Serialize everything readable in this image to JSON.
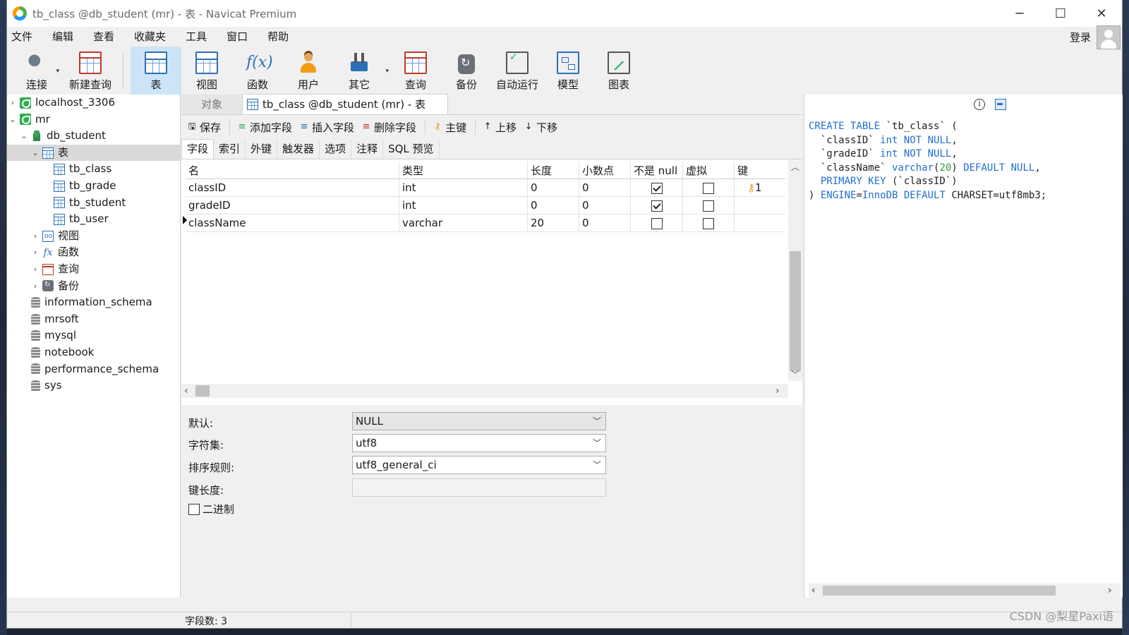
{
  "window": {
    "title": "tb_class @db_student (mr) - 表 - Navicat Premium",
    "controls": {
      "minimize": "─",
      "maximize": "☐",
      "close": "✕"
    }
  },
  "menubar": {
    "items": [
      "文件",
      "编辑",
      "查看",
      "收藏夹",
      "工具",
      "窗口",
      "帮助"
    ],
    "login": "登录"
  },
  "toolbar": {
    "items": [
      {
        "label": "连接",
        "icon": "connect-icon"
      },
      {
        "label": "新建查询",
        "icon": "new-query-icon"
      },
      {
        "label": "表",
        "icon": "table-icon",
        "active": true
      },
      {
        "label": "视图",
        "icon": "view-icon"
      },
      {
        "label": "函数",
        "icon": "function-icon"
      },
      {
        "label": "用户",
        "icon": "user-icon"
      },
      {
        "label": "其它",
        "icon": "tools-icon"
      },
      {
        "label": "查询",
        "icon": "query-icon"
      },
      {
        "label": "备份",
        "icon": "backup-icon"
      },
      {
        "label": "自动运行",
        "icon": "auto-run-icon"
      },
      {
        "label": "模型",
        "icon": "model-icon"
      },
      {
        "label": "图表",
        "icon": "chart-icon"
      }
    ]
  },
  "sidebar": {
    "items": [
      {
        "label": "localhost_3306",
        "icon": "connection-icon",
        "level": 0,
        "twisty": "›"
      },
      {
        "label": "mr",
        "icon": "connection-icon",
        "level": 0,
        "twisty": "⌄"
      },
      {
        "label": "db_student",
        "icon": "database-icon",
        "level": 1,
        "twisty": "⌄"
      },
      {
        "label": "表",
        "icon": "table-folder-icon",
        "level": 2,
        "twisty": "⌄",
        "selected": true
      },
      {
        "label": "tb_class",
        "icon": "table-icon",
        "level": 3
      },
      {
        "label": "tb_grade",
        "icon": "table-icon",
        "level": 3
      },
      {
        "label": "tb_student",
        "icon": "table-icon",
        "level": 3
      },
      {
        "label": "tb_user",
        "icon": "table-icon",
        "level": 3
      },
      {
        "label": "视图",
        "icon": "view-icon",
        "level": 2,
        "twisty": "›"
      },
      {
        "label": "函数",
        "icon": "function-icon",
        "level": 2,
        "twisty": "›"
      },
      {
        "label": "查询",
        "icon": "query-icon",
        "level": 2,
        "twisty": "›"
      },
      {
        "label": "备份",
        "icon": "backup-icon",
        "level": 2,
        "twisty": "›"
      },
      {
        "label": "information_schema",
        "icon": "database-gray-icon",
        "level": 1
      },
      {
        "label": "mrsoft",
        "icon": "database-gray-icon",
        "level": 1
      },
      {
        "label": "mysql",
        "icon": "database-gray-icon",
        "level": 1
      },
      {
        "label": "notebook",
        "icon": "database-gray-icon",
        "level": 1
      },
      {
        "label": "performance_schema",
        "icon": "database-gray-icon",
        "level": 1
      },
      {
        "label": "sys",
        "icon": "database-gray-icon",
        "level": 1
      }
    ]
  },
  "tabs": {
    "object": "对象",
    "active": "tb_class @db_student (mr) - 表"
  },
  "actions": {
    "save": "保存",
    "add_field": "添加字段",
    "insert_field": "插入字段",
    "delete_field": "删除字段",
    "primary_key": "主键",
    "move_up": "上移",
    "move_down": "下移"
  },
  "subtabs": [
    "字段",
    "索引",
    "外键",
    "触发器",
    "选项",
    "注释",
    "SQL 预览"
  ],
  "fields_table": {
    "headers": [
      "名",
      "类型",
      "长度",
      "小数点",
      "不是 null",
      "虚拟",
      "键"
    ],
    "rows": [
      {
        "name": "classID",
        "type": "int",
        "length": "0",
        "decimals": "0",
        "not_null": true,
        "virtual": false,
        "key": "1"
      },
      {
        "name": "gradeID",
        "type": "int",
        "length": "0",
        "decimals": "0",
        "not_null": true,
        "virtual": false,
        "key": ""
      },
      {
        "name": "className",
        "type": "varchar",
        "length": "20",
        "decimals": "0",
        "not_null": false,
        "virtual": false,
        "key": ""
      }
    ]
  },
  "properties": {
    "default_label": "默认:",
    "default_value": "NULL",
    "charset_label": "字符集:",
    "charset_value": "utf8",
    "collation_label": "排序规则:",
    "collation_value": "utf8_general_ci",
    "key_length_label": "键长度:",
    "key_length_value": "",
    "binary_label": "二进制"
  },
  "ddl_lines": [
    "CREATE TABLE `tb_class` (",
    "  `classID` int NOT NULL,",
    "  `gradeID` int NOT NULL,",
    "  `className` varchar(20) DEFAULT NULL,",
    "  PRIMARY KEY (`classID`)",
    ") ENGINE=InnoDB DEFAULT CHARSET=utf8mb3;"
  ],
  "status": {
    "field_count": "字段数: 3"
  },
  "watermark": "CSDN @梨星Paxi语",
  "colors": {
    "keyword": "#1f6fd1",
    "number": "#2e9c3a",
    "active_toolbar": "#cce4f7"
  }
}
